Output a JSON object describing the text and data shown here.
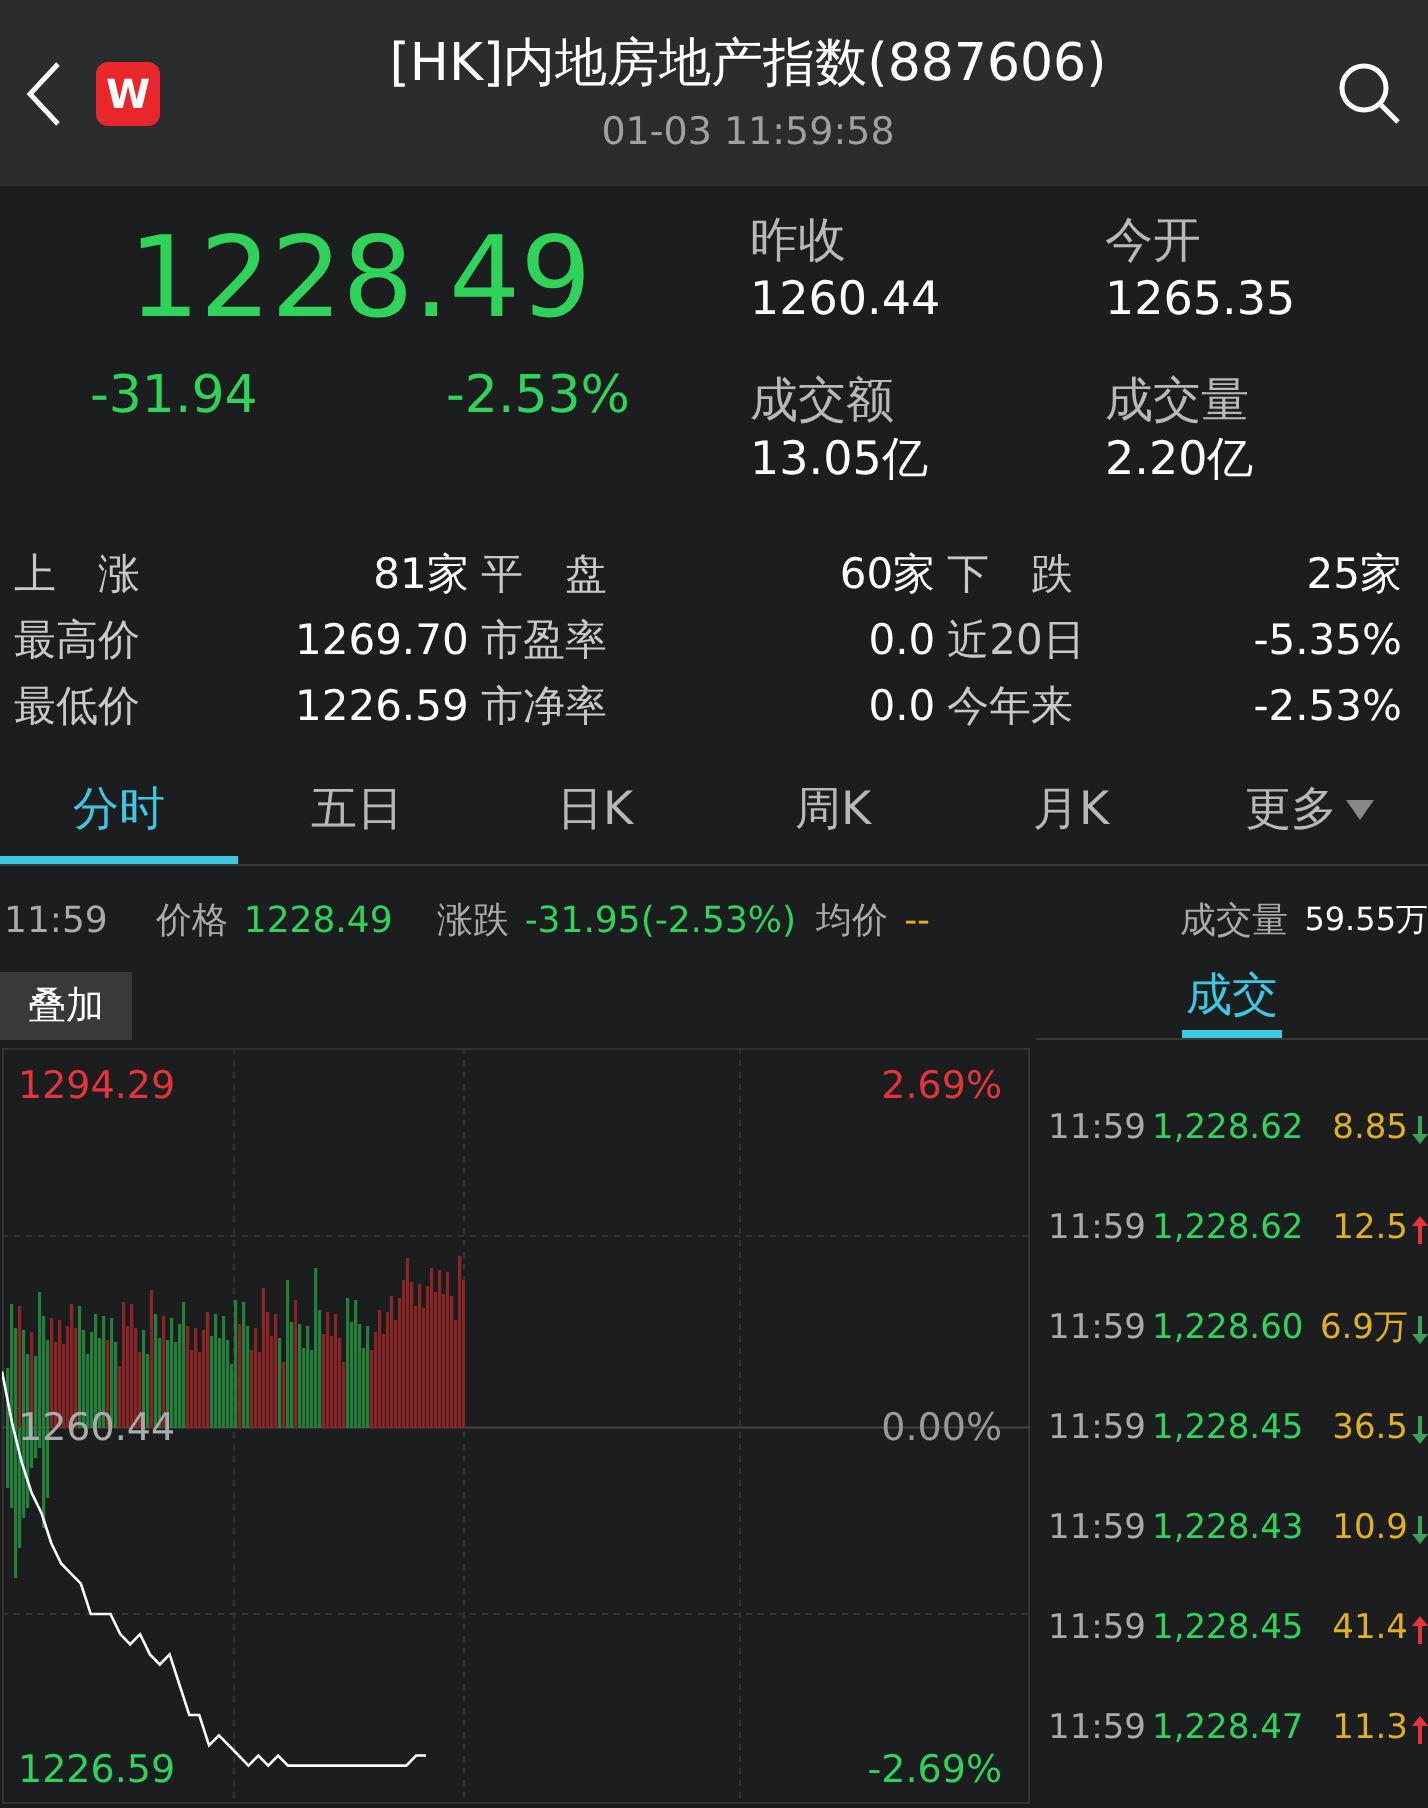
{
  "header": {
    "title": "[HK]内地房地产指数(887606)",
    "timestamp": "01-03 11:59:58",
    "logo_letter": "W"
  },
  "quote": {
    "price": "1228.49",
    "change": "-31.94",
    "change_pct": "-2.53%",
    "kind": "down",
    "fields": [
      {
        "label": "昨收",
        "value": "1260.44"
      },
      {
        "label": "今开",
        "value": "1265.35"
      },
      {
        "label": "成交额",
        "value": "13.05亿"
      },
      {
        "label": "成交量",
        "value": "2.20亿"
      }
    ]
  },
  "stats": [
    [
      {
        "label": "上　涨",
        "value": "81家"
      },
      {
        "label": "平　盘",
        "value": "60家"
      },
      {
        "label": "下　跌",
        "value": "25家"
      }
    ],
    [
      {
        "label": "最高价",
        "value": "1269.70"
      },
      {
        "label": "市盈率",
        "value": "0.0"
      },
      {
        "label": "近20日",
        "value": "-5.35%"
      }
    ],
    [
      {
        "label": "最低价",
        "value": "1226.59"
      },
      {
        "label": "市净率",
        "value": "0.0"
      },
      {
        "label": "今年来",
        "value": "-2.53%"
      }
    ]
  ],
  "tabs": [
    {
      "label": "分时",
      "selected": true
    },
    {
      "label": "五日",
      "selected": false
    },
    {
      "label": "日K",
      "selected": false
    },
    {
      "label": "周K",
      "selected": false
    },
    {
      "label": "月K",
      "selected": false
    },
    {
      "label": "更多",
      "selected": false,
      "dropdown": true
    }
  ],
  "info_bar": {
    "time": "11:59",
    "price_label": "价格",
    "price": "1228.49",
    "change_label": "涨跌",
    "change": "-31.95(-2.53%)",
    "avg_label": "均价",
    "avg": "--",
    "volume_label": "成交量",
    "volume": "59.55万"
  },
  "overlay_button": "叠加",
  "chart": {
    "chart_data": {
      "type": "line",
      "categories": [
        null,
        null,
        null,
        null,
        null,
        null,
        null,
        null,
        null,
        null,
        null,
        null,
        null,
        null,
        null,
        null,
        null,
        null,
        null,
        null,
        null,
        null,
        null,
        null,
        null,
        null,
        null,
        null,
        null,
        null,
        null,
        null,
        null,
        null,
        null,
        null,
        null,
        null,
        null,
        null,
        null,
        null,
        null,
        null
      ],
      "ylim": [
        1223.2,
        1298.0
      ],
      "yticks": [
        {
          "value": 1294.29,
          "label": "1294.29"
        },
        {
          "value": 1260.44,
          "label": "1260.44"
        },
        {
          "value": 1226.59,
          "label": "1226.59"
        }
      ],
      "series": [
        {
          "color": "#ffffff",
          "values": [
            1266,
            1261,
            1257,
            1254,
            1252,
            1249,
            1247,
            1246,
            1245,
            1242,
            1242,
            1242,
            1240,
            1239,
            1240,
            1238,
            1237,
            1238,
            1235,
            1232,
            1232,
            1229,
            1230,
            1229,
            1228,
            1227,
            1228,
            1227,
            1228,
            1227,
            1227,
            1227,
            1227,
            1227,
            1227,
            1227,
            1227,
            1227,
            1227,
            1227,
            1227,
            1227,
            1228,
            1228
          ]
        }
      ]
    },
    "top_pct": "2.69%",
    "mid_pct": "0.00%",
    "bottom_pct": "-2.69%"
  },
  "trades_tab": {
    "label": "成交",
    "selected": true
  },
  "trades": [
    {
      "time": "11:59",
      "price": "1,228.62",
      "volume": "8.85",
      "kind": "down"
    },
    {
      "time": "11:59",
      "price": "1,228.62",
      "volume": "12.5",
      "kind": "up"
    },
    {
      "time": "11:59",
      "price": "1,228.60",
      "volume": "6.9万",
      "kind": "down"
    },
    {
      "time": "11:59",
      "price": "1,228.45",
      "volume": "36.5",
      "kind": "down"
    },
    {
      "time": "11:59",
      "price": "1,228.43",
      "volume": "10.9",
      "kind": "down"
    },
    {
      "time": "11:59",
      "price": "1,228.45",
      "volume": "41.4",
      "kind": "up"
    },
    {
      "time": "11:59",
      "price": "1,228.47",
      "volume": "11.3",
      "kind": "up"
    }
  ]
}
